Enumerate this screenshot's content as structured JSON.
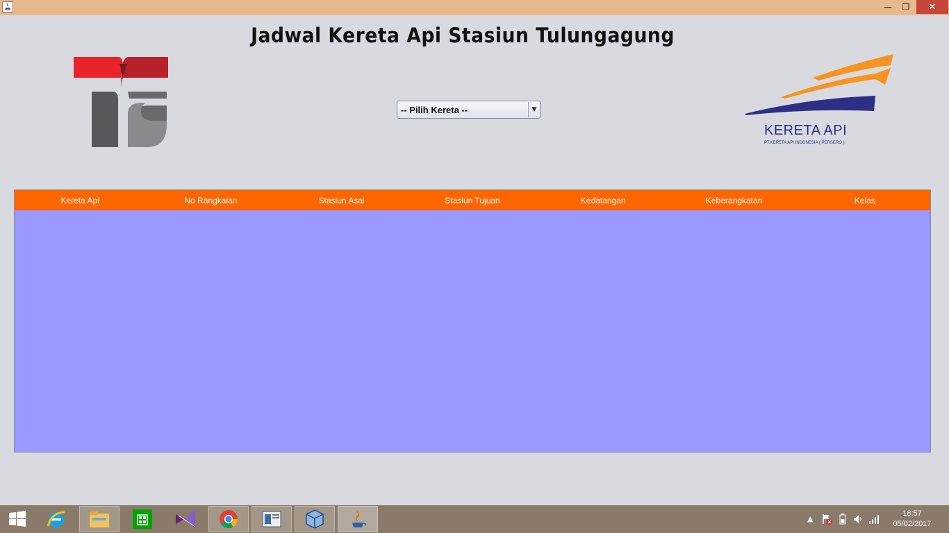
{
  "window": {
    "minimize_glyph": "—",
    "restore_glyph": "❐",
    "close_glyph": "✕"
  },
  "page": {
    "title": "Jadwal Kereta Api Stasiun Tulungagung"
  },
  "logo_right": {
    "brand": "KERETA API",
    "subtitle": "PT.KERETA API INDONESIA ( PERSERO )",
    "colors": {
      "orange": "#f7931e",
      "blue": "#2d2e86"
    }
  },
  "logo_left": {
    "colors": {
      "red": "#e8232a",
      "gray": "#58585a"
    }
  },
  "train_select": {
    "selected": "-- Pilih Kereta --",
    "arrow_glyph": "▼"
  },
  "table": {
    "columns": [
      "Kereta Api",
      "No Rangkaian",
      "Stasiun Asal",
      "Stasiun Tujuan",
      "Kedatangan",
      "Keberangkatan",
      "Kelas"
    ],
    "rows": [],
    "header_color": "#ff6600",
    "body_color": "#9999ff"
  },
  "taskbar": {
    "items": [
      "windows-start-icon",
      "internet-explorer-icon",
      "file-explorer-icon",
      "store-icon",
      "visual-studio-icon",
      "chrome-icon",
      "app-window-icon",
      "virtualbox-icon",
      "java-icon"
    ],
    "tray_up_glyph": "▲",
    "time": "18:57",
    "date": "05/02/2017"
  }
}
